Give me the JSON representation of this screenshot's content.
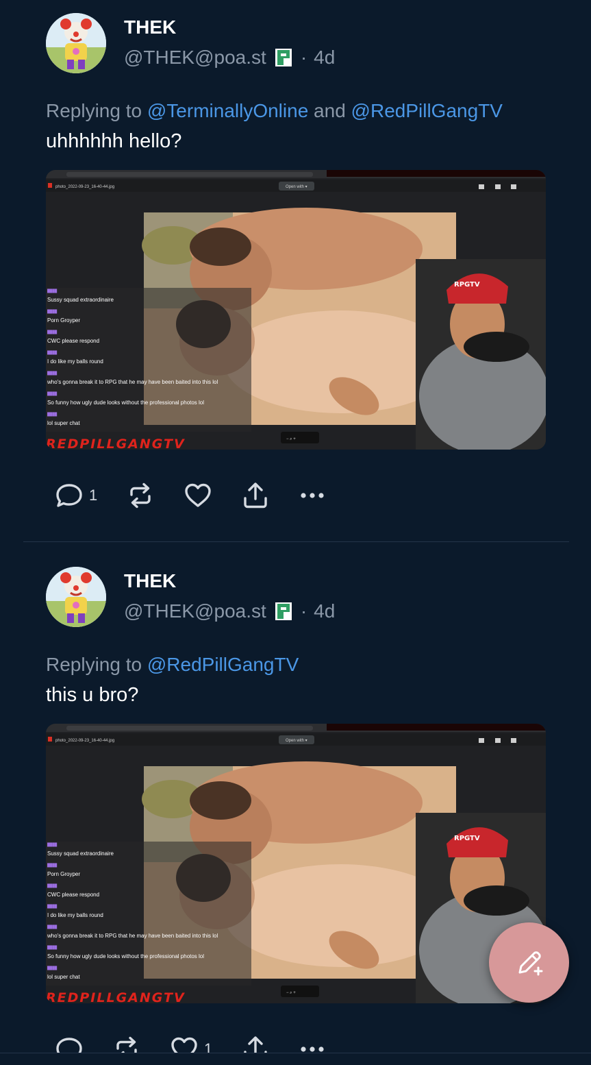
{
  "posts": [
    {
      "author_name": "THEK",
      "handle": "@THEK@poa.st",
      "separator": "·",
      "time": "4d",
      "replying_prefix": "Replying to",
      "mentions": [
        "@TerminallyOnline",
        "@RedPillGangTV"
      ],
      "mention_joiner": "and",
      "text": "uhhhhhh hello?",
      "media": {
        "filename": "photo_2022-09-23_16-40-44.jpg",
        "open_with": "Open with ▾",
        "chat": [
          {
            "user": "████",
            "msg": "Sussy squad extraordinaire"
          },
          {
            "user": "████",
            "msg": "Porn Groyper"
          },
          {
            "user": "████",
            "msg": "CWC please respond"
          },
          {
            "user": "████",
            "msg": "I do like my balls round"
          },
          {
            "user": "████",
            "msg": "who's gonna break it to RPG that he may have been baited into this lol"
          },
          {
            "user": "████",
            "msg": "So funny how ugly dude looks without the professional photos lol"
          },
          {
            "user": "████",
            "msg": "lol super chat"
          }
        ],
        "logo": "REDPILLGANGTV",
        "hat_text": "RPGTV"
      },
      "actions": {
        "replies": "1",
        "reposts": "",
        "likes": ""
      }
    },
    {
      "author_name": "THEK",
      "handle": "@THEK@poa.st",
      "separator": "·",
      "time": "4d",
      "replying_prefix": "Replying to",
      "mentions": [
        "@RedPillGangTV"
      ],
      "text": "this u bro?",
      "media": {
        "filename": "photo_2022-09-23_16-40-44.jpg",
        "open_with": "Open with ▾",
        "logo": "REDPILLGANGTV",
        "hat_text": "RPGTV"
      },
      "actions": {
        "replies": "",
        "reposts": "",
        "likes": "1"
      }
    }
  ],
  "colors": {
    "background": "#0b1a2b",
    "muted": "#8b98a8",
    "mention": "#4b97e6",
    "fab": "#d79899"
  },
  "icons": [
    "reply-icon",
    "repost-icon",
    "like-icon",
    "share-icon",
    "more-icon",
    "compose-icon",
    "instance-icon"
  ]
}
